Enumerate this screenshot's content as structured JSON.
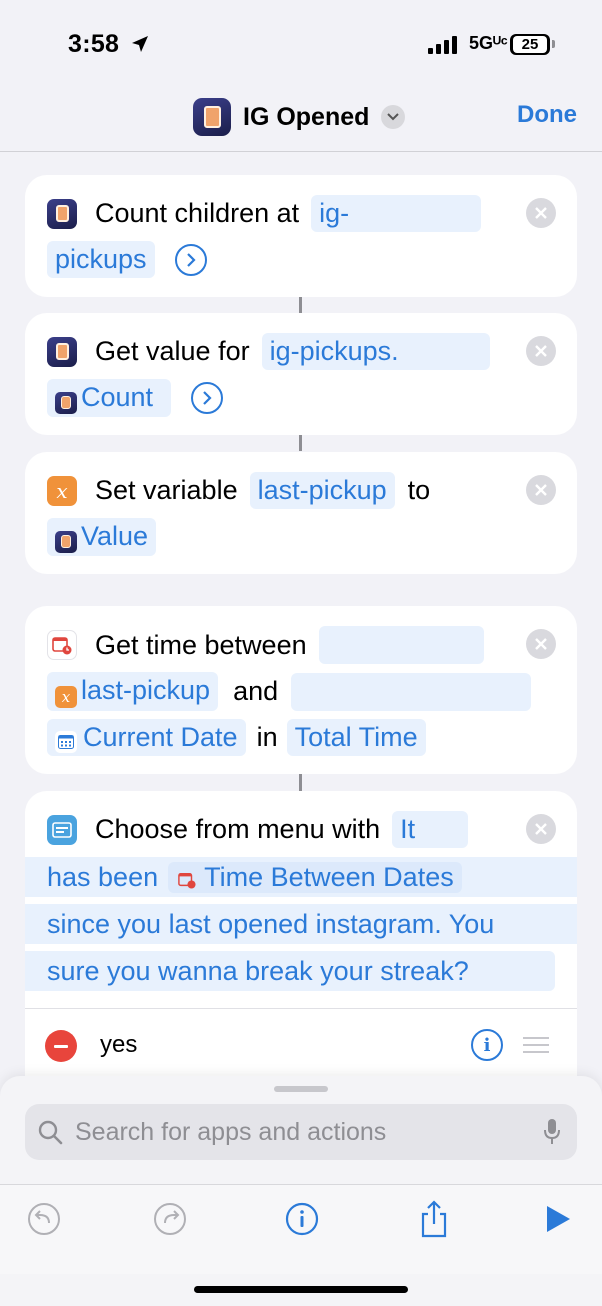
{
  "status_bar": {
    "time": "3:58",
    "network": "5Gᵁᶜ",
    "battery": "25"
  },
  "nav": {
    "title": "IG Opened",
    "done_label": "Done"
  },
  "actions": {
    "count": {
      "label": "Count children at",
      "token_line1": "ig-",
      "token_line2": "pickups"
    },
    "get_value": {
      "label": "Get value for",
      "token": "ig-pickups.",
      "token2": "Count"
    },
    "set_var": {
      "label": "Set variable",
      "var_name": "last-pickup",
      "to_label": "to",
      "value": "Value"
    },
    "time_between": {
      "label": "Get time between",
      "var": "last-pickup",
      "and_label": "and",
      "date": "Current Date",
      "in_label": "in",
      "unit": "Total Time"
    },
    "menu": {
      "label": "Choose from menu with",
      "prompt_1": "It",
      "prompt_2": "has been",
      "prompt_var": "Time Between Dates",
      "prompt_3": "since you last opened instagram. You",
      "prompt_4": "sure you wanna break your streak?",
      "option": "yes"
    }
  },
  "search": {
    "placeholder": "Search for apps and actions"
  },
  "icons": {
    "app": "jar-app-icon",
    "variable": "variable-x-icon",
    "date": "calendar-clock-icon",
    "menu": "menu-list-icon"
  },
  "colors": {
    "accent": "#2b7ad8",
    "variable": "#f0923a",
    "delete": "#e8453c"
  }
}
